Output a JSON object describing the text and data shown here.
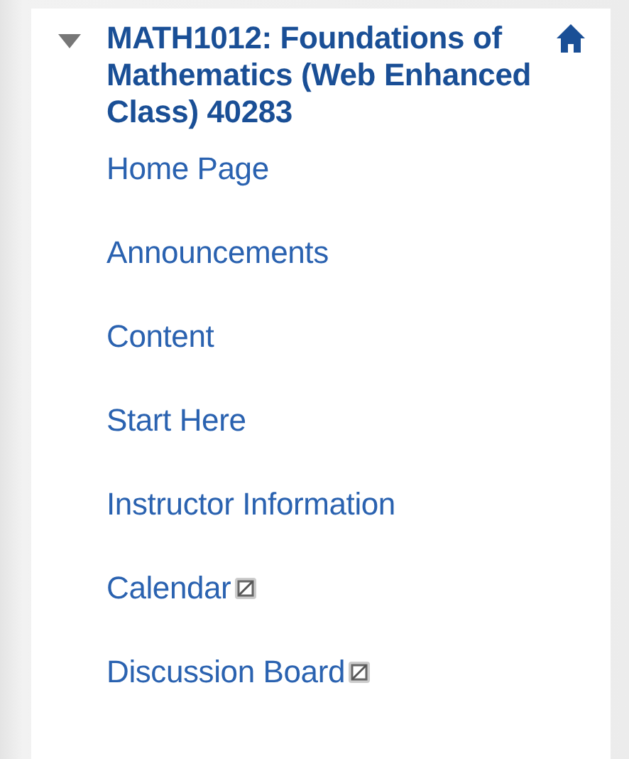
{
  "course": {
    "title": "MATH1012: Foundations of Mathematics (Web Enhanced Class) 40283",
    "expanded": true
  },
  "menu": [
    {
      "label": "Home Page",
      "hidden": false
    },
    {
      "label": "Announcements",
      "hidden": false
    },
    {
      "label": "Content",
      "hidden": false
    },
    {
      "label": "Start Here",
      "hidden": false
    },
    {
      "label": "Instructor Information",
      "hidden": false
    },
    {
      "label": "Calendar",
      "hidden": true
    },
    {
      "label": "Discussion Board",
      "hidden": true
    }
  ]
}
